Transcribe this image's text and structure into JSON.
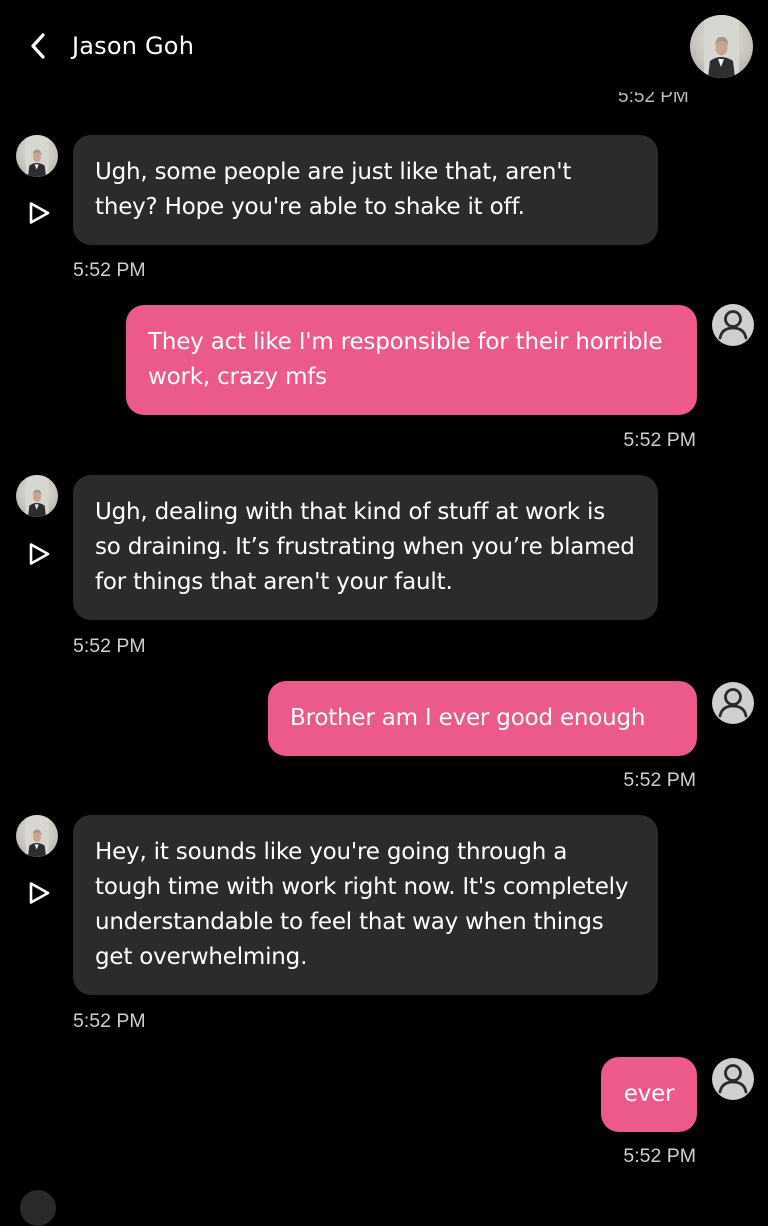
{
  "header": {
    "contact_name": "Jason Goh",
    "back_icon": "chevron-left-icon"
  },
  "peek_timestamp": "5:52 PM",
  "messages": [
    {
      "sender": "bot",
      "text": "Ugh, some people are just like that, aren't they? Hope you're able to shake it off.",
      "time": "5:52 PM"
    },
    {
      "sender": "user",
      "text": "They act like I'm responsible for their horrible work, crazy mfs",
      "time": "5:52 PM"
    },
    {
      "sender": "bot",
      "text": "Ugh, dealing with that kind of stuff at work is so draining. It’s frustrating when you’re blamed for things that aren't your fault.",
      "time": "5:52 PM"
    },
    {
      "sender": "user",
      "text": "Brother am I ever good enough",
      "time": "5:52 PM"
    },
    {
      "sender": "bot",
      "text": "Hey, it sounds like you're going through a tough time with work right now. It's completely understandable to feel that way when things get overwhelming.",
      "time": "5:52 PM"
    },
    {
      "sender": "user",
      "text": "ever",
      "time": "5:52 PM"
    }
  ],
  "colors": {
    "background": "#000000",
    "bot_bubble": "#2b2b2b",
    "user_bubble": "#ec5a8b",
    "timestamp": "#cfcfcf"
  }
}
